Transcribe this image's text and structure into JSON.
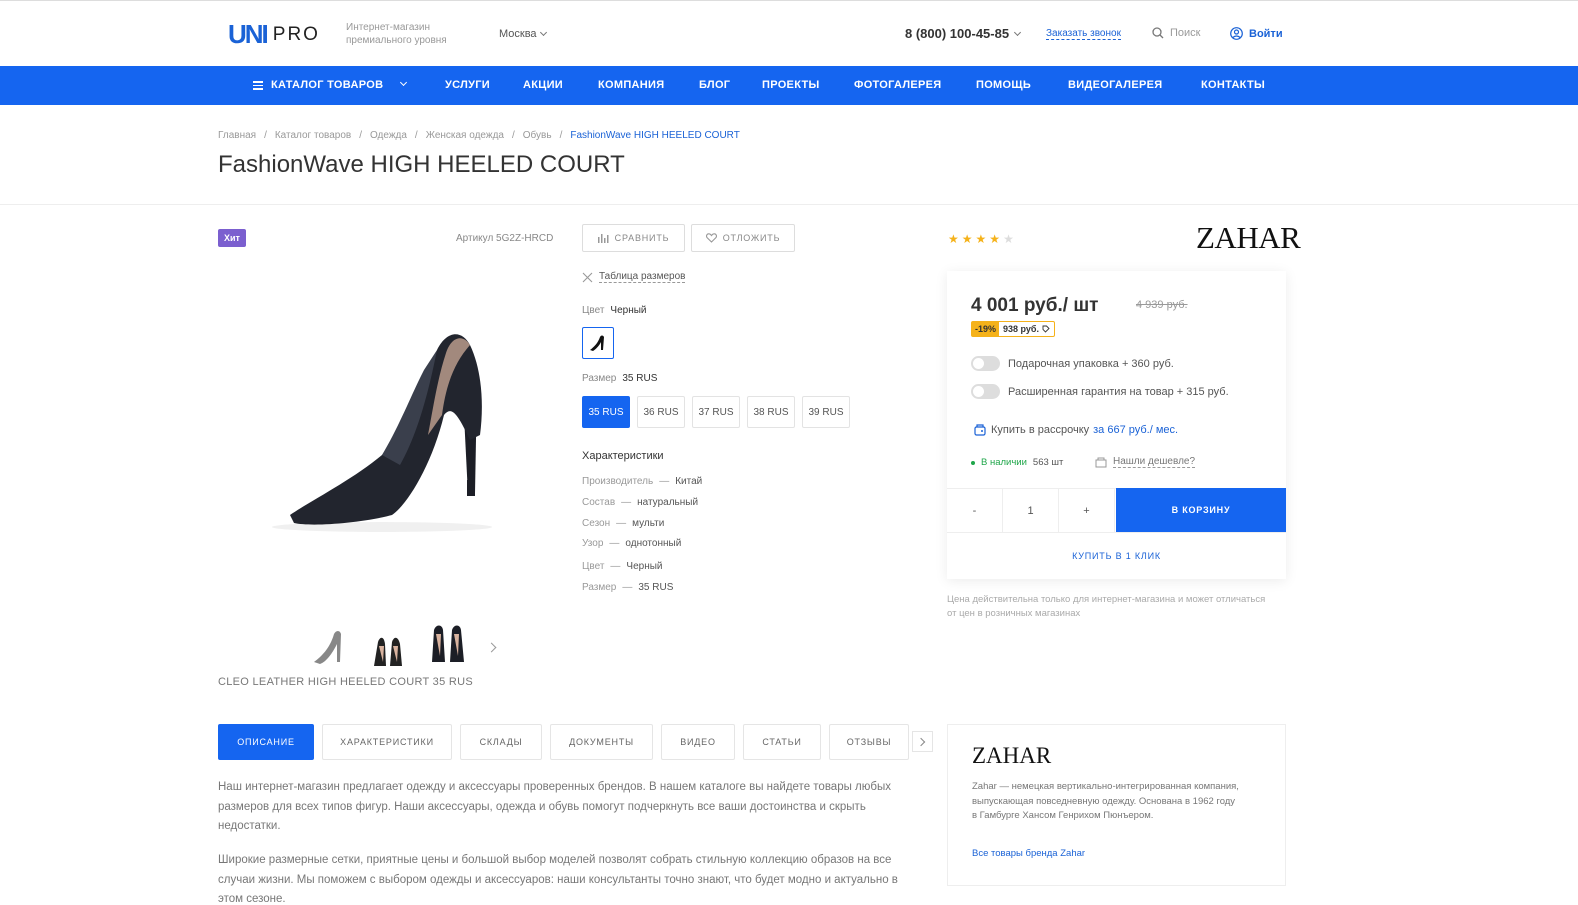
{
  "header": {
    "logo_mark": "UNI",
    "logo_text": "PRO",
    "slogan": "Интернет-магазин премиального уровня",
    "city": "Москва",
    "phone": "8 (800) 100-45-85",
    "callback": "Заказать звонок",
    "search": "Поиск",
    "login": "Войти"
  },
  "nav": {
    "catalog": "КАТАЛОГ ТОВАРОВ",
    "items": [
      "УСЛУГИ",
      "АКЦИИ",
      "КОМПАНИЯ",
      "БЛОГ",
      "ПРОЕКТЫ",
      "ФОТОГАЛЕРЕЯ",
      "ПОМОЩЬ",
      "ВИДЕОГАЛЕРЕЯ",
      "КОНТАКТЫ"
    ]
  },
  "breadcrumbs": [
    "Главная",
    "Каталог товаров",
    "Одежда",
    "Женская одежда",
    "Обувь",
    "FashionWave HIGH HEELED COURT"
  ],
  "breadcrumb_sep": "/",
  "product": {
    "title": "FashionWave HIGH HEELED COURT",
    "badge": "Хит",
    "sku": "Артикул 5G2Z-HRCD",
    "compare": "СРАВНИТЬ",
    "favorite": "ОТЛОЖИТЬ",
    "size_table": "Таблица размеров",
    "color_label": "Цвет",
    "color_value": "Черный",
    "size_label": "Размер",
    "size_value": "35 RUS",
    "sizes": [
      "35 RUS",
      "36 RUS",
      "37 RUS",
      "38 RUS",
      "39 RUS"
    ],
    "chars_title": "Характеристики",
    "chars": [
      {
        "k": "Производитель",
        "v": "Китай"
      },
      {
        "k": "Состав",
        "v": "натуральный"
      },
      {
        "k": "Сезон",
        "v": "мульти"
      },
      {
        "k": "Узор",
        "v": "однотонный"
      },
      {
        "k": "Цвет",
        "v": "Черный"
      },
      {
        "k": "Размер",
        "v": "35 RUS"
      }
    ],
    "char_sep": "—",
    "image_caption": "CLEO LEATHER HIGH HEELED COURT 35 RUS",
    "rating": 4,
    "rating_max": 5
  },
  "buy": {
    "brand": "ZAHAR",
    "price": "4 001 руб./ шт",
    "old_price": "4 939 руб.",
    "discount_pct": "-19%",
    "discount_amount": "938 руб.",
    "options": [
      "Подарочная упаковка + 360 руб.",
      "Расширенная гарантия на товар + 315 руб."
    ],
    "credit_text": "Купить в рассрочку",
    "credit_link": "за 667 руб./ мес.",
    "stock_label": "В наличии",
    "stock_count": "563 шт",
    "cheaper": "Нашли дешевле?",
    "qty_minus": "-",
    "qty_value": "1",
    "qty_plus": "+",
    "cart": "В КОРЗИНУ",
    "one_click": "КУПИТЬ В 1 КЛИК",
    "note": "Цена действительна только для интернет-магазина и может отличаться от цен в розничных магазинах"
  },
  "tabs": [
    "ОПИСАНИЕ",
    "ХАРАКТЕРИСТИКИ",
    "СКЛАДЫ",
    "ДОКУМЕНТЫ",
    "ВИДЕО",
    "СТАТЬИ",
    "ОТЗЫВЫ"
  ],
  "description": [
    "Наш интернет-магазин предлагает одежду и аксессуары проверенных брендов. В нашем каталоге вы найдете товары любых размеров для всех типов фигур. Наши аксессуары, одежда и обувь помогут подчеркнуть все ваши достоинства и скрыть недостатки.",
    "Широкие размерные сетки, приятные цены и большой выбор моделей позволят собрать стильную коллекцию образов на все случаи жизни. Мы поможем с выбором одежды и аксессуаров: наши консультанты точно знают, что будет модно и актуально в этом сезоне."
  ],
  "brand_box": {
    "logo": "ZAHAR",
    "text": "Zahar — немецкая вертикально-интегрированная компания, выпускающая повседневную одежду. Основана в 1962 году в Гамбурге Хансом Генрихом Пюнъером.",
    "link": "Все товары бренда Zahar"
  },
  "colors": {
    "accent": "#1565f0",
    "badge": "#7b5fcf",
    "star": "#f5b21a",
    "stock": "#1fa64a"
  }
}
